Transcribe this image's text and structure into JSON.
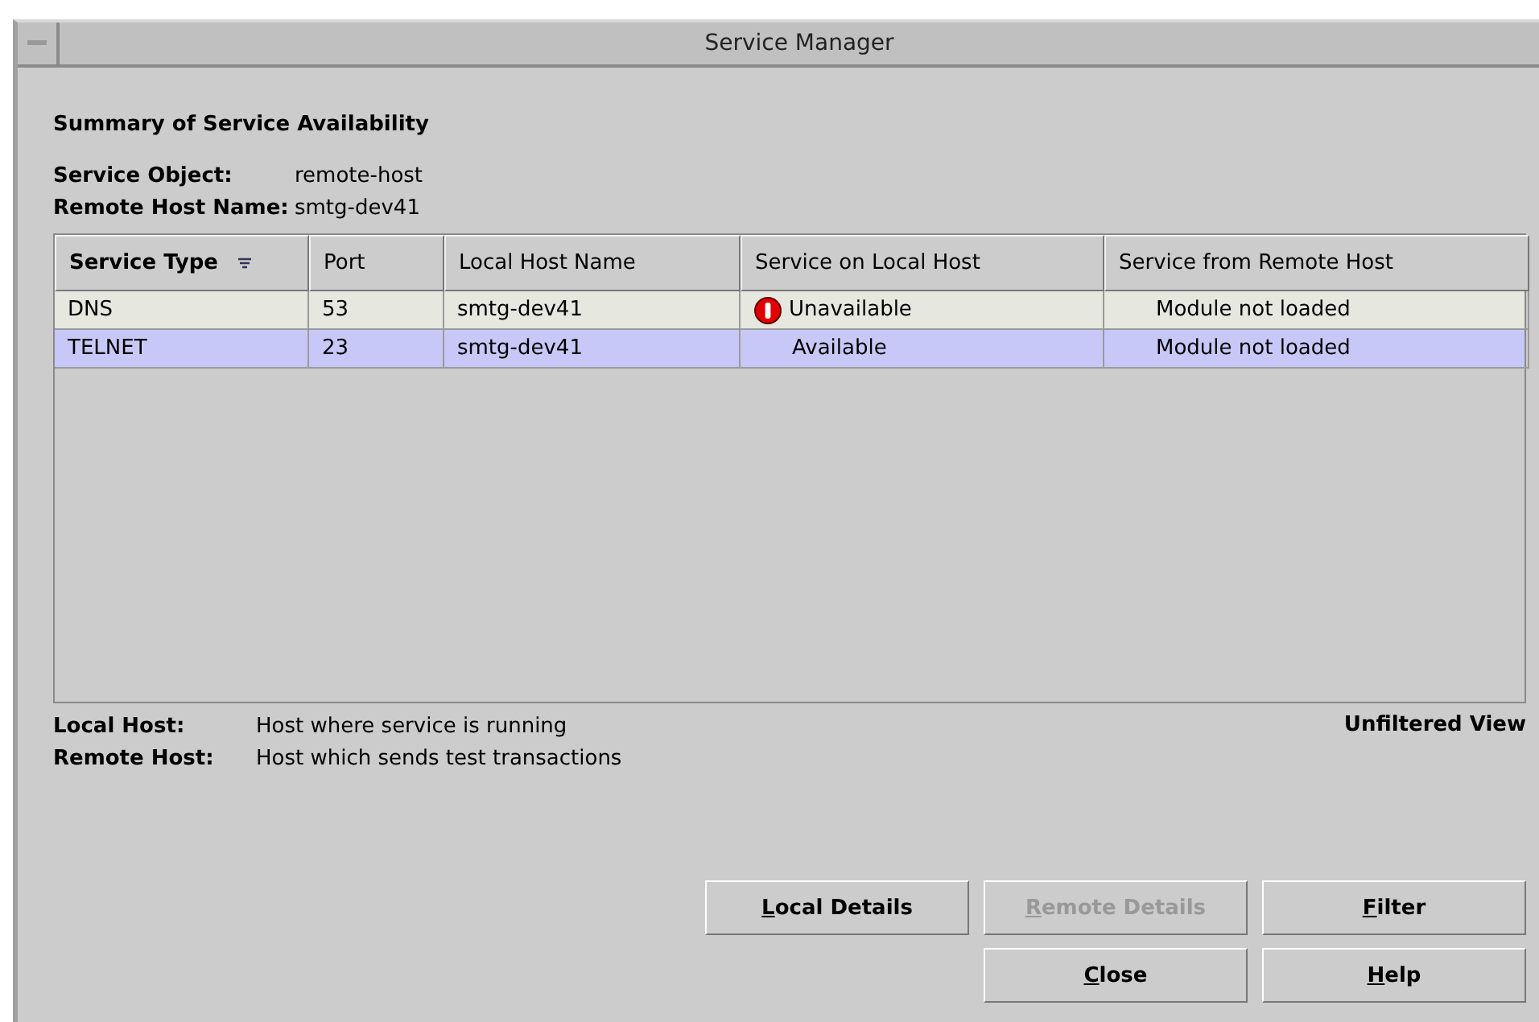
{
  "window": {
    "title": "Service Manager"
  },
  "summary": {
    "heading": "Summary of Service Availability",
    "fields": [
      {
        "label": "Service Object:",
        "value": "remote-host"
      },
      {
        "label": "Remote Host Name:",
        "value": "smtg-dev41"
      }
    ]
  },
  "table": {
    "columns": [
      {
        "label": "Service Type",
        "sorted": true
      },
      {
        "label": "Port",
        "sorted": false
      },
      {
        "label": "Local Host Name",
        "sorted": false
      },
      {
        "label": "Service on Local Host",
        "sorted": false
      },
      {
        "label": "Service from Remote Host",
        "sorted": false
      }
    ],
    "rows": [
      {
        "selected": false,
        "cells": [
          "DNS",
          "53",
          "smtg-dev41",
          "Unavailable",
          "Module not loaded"
        ],
        "local_alert": true
      },
      {
        "selected": true,
        "cells": [
          "TELNET",
          "23",
          "smtg-dev41",
          "Available",
          "Module not loaded"
        ],
        "local_alert": false
      }
    ]
  },
  "legend": [
    {
      "label": "Local Host:",
      "text": "Host where service is running"
    },
    {
      "label": "Remote Host:",
      "text": "Host which sends test transactions"
    }
  ],
  "view_label": "Unfiltered View",
  "buttons": [
    [
      {
        "label": "Local Details",
        "disabled": false
      },
      {
        "label": "Remote Details",
        "disabled": true
      },
      {
        "label": "Filter",
        "disabled": false
      }
    ],
    [
      {
        "label": "Close",
        "disabled": false
      },
      {
        "label": "Help",
        "disabled": false
      }
    ]
  ]
}
